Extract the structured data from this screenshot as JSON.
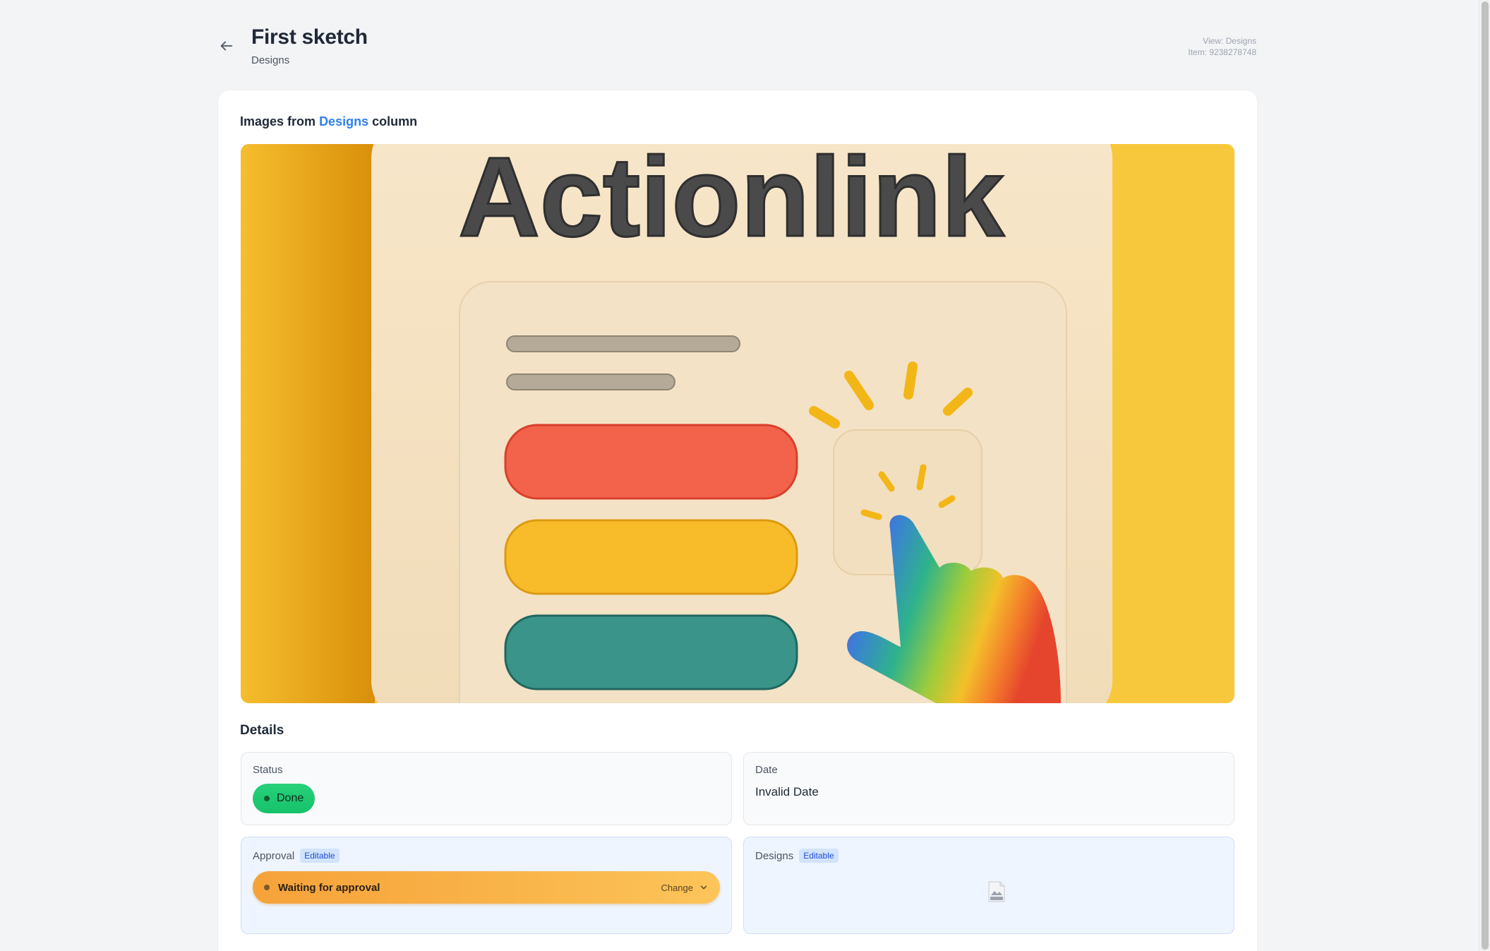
{
  "header": {
    "title": "First sketch",
    "subtitle": "Designs",
    "meta_view": "View: Designs",
    "meta_item": "Item: 9238278748"
  },
  "images_section": {
    "prefix": "Images from",
    "column_name": "Designs",
    "suffix": "column",
    "image_wordmark": "Actionlink"
  },
  "details": {
    "heading": "Details",
    "status": {
      "label": "Status",
      "value": "Done",
      "color": "#22c55e"
    },
    "date": {
      "label": "Date",
      "value": "Invalid Date"
    },
    "approval": {
      "label": "Approval",
      "badge": "Editable",
      "value": "Waiting for approval",
      "action": "Change",
      "color": "#f9b449"
    },
    "designs": {
      "label": "Designs",
      "badge": "Editable",
      "file_icon": "image-file-icon"
    }
  },
  "icons": {
    "back": "arrow-left-icon",
    "change_chevron": "chevron-down-icon"
  }
}
